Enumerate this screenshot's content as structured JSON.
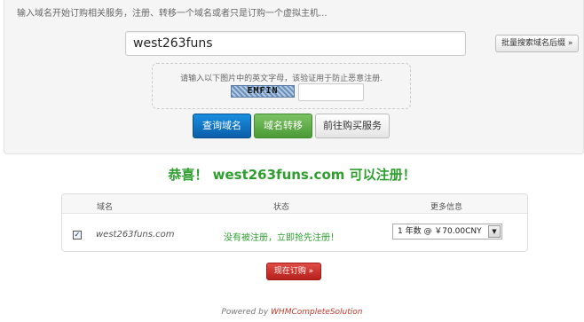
{
  "search": {
    "intro": "输入域名开始订购相关服务，注册、转移一个域名或者只是订购一个虚拟主机...",
    "domain_value": "west263funs",
    "bulk_button": "批量搜索域名后缀 »",
    "captcha_hint": "请输入以下图片中的英文字母，该验证用于防止恶意注册.",
    "captcha_text": "EMFIN",
    "captcha_value": "",
    "search_button": "查询域名",
    "transfer_button": "域名转移",
    "buy_button": "前往购买服务"
  },
  "result": {
    "congrats_prefix": "恭喜！",
    "domain": "west263funs.com",
    "congrats_suffix": "可以注册！",
    "headers": {
      "domain": "域名",
      "status": "状态",
      "more": "更多信息"
    },
    "row": {
      "checked": true,
      "domain": "west263funs.com",
      "status": "没有被注册，立即抢先注册！",
      "term_selected": "1 年数 @ ￥70.00CNY"
    }
  },
  "order_button": "现在订购 »",
  "footer": {
    "prefix": "Powered by",
    "brand": "WHMCompleteSolution"
  },
  "colors": {
    "primary": "#0a6fc4",
    "success": "#2f9e2f",
    "danger": "#c8302b"
  }
}
